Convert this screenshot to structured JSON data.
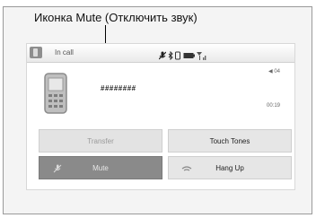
{
  "callout": {
    "label": "Иконка Mute (Отключить звук)"
  },
  "status_bar": {
    "title": "In call"
  },
  "call": {
    "number": "########",
    "volume": "◀ 04",
    "timer": "00:19"
  },
  "buttons": {
    "transfer": "Transfer",
    "touch_tones": "Touch Tones",
    "mute": "Mute",
    "hang_up": "Hang Up"
  },
  "icons": {
    "tab": "phone-tab-icon",
    "status": [
      "mute-icon",
      "bluetooth-icon",
      "hfl-icon",
      "battery-icon",
      "signal-icon"
    ],
    "mute_button": "microphone-off-icon",
    "hangup_button": "hang-up-icon"
  }
}
